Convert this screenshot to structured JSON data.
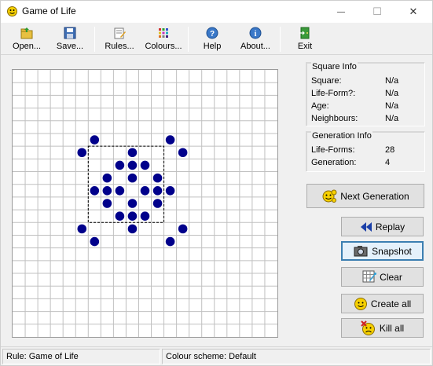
{
  "window": {
    "title": "Game of Life",
    "controls": {
      "minimize": "—",
      "maximize": "☐",
      "close": "✕"
    }
  },
  "toolbar": {
    "items": [
      {
        "label": "Open...",
        "icon": "open-folder-icon"
      },
      {
        "label": "Save...",
        "icon": "floppy-disk-icon"
      },
      {
        "label": "Rules...",
        "icon": "rules-icon"
      },
      {
        "label": "Colours...",
        "icon": "colour-palette-icon"
      },
      {
        "label": "Help",
        "icon": "help-icon"
      },
      {
        "label": "About...",
        "icon": "info-icon"
      },
      {
        "label": "Exit",
        "icon": "exit-door-icon"
      }
    ]
  },
  "grid": {
    "columns": 21,
    "rows": 21,
    "cell_color": "#00008b",
    "line_color": "#c0c0c0",
    "live_cells": [
      [
        6,
        5
      ],
      [
        12,
        5
      ],
      [
        5,
        6
      ],
      [
        9,
        6
      ],
      [
        13,
        6
      ],
      [
        8,
        7
      ],
      [
        9,
        7
      ],
      [
        10,
        7
      ],
      [
        7,
        8
      ],
      [
        9,
        8
      ],
      [
        11,
        8
      ],
      [
        6,
        9
      ],
      [
        7,
        9
      ],
      [
        8,
        9
      ],
      [
        10,
        9
      ],
      [
        11,
        9
      ],
      [
        12,
        9
      ],
      [
        7,
        10
      ],
      [
        9,
        10
      ],
      [
        11,
        10
      ],
      [
        8,
        11
      ],
      [
        9,
        11
      ],
      [
        10,
        11
      ],
      [
        5,
        12
      ],
      [
        9,
        12
      ],
      [
        13,
        12
      ],
      [
        6,
        13
      ],
      [
        12,
        13
      ]
    ],
    "selection": {
      "col_start": 6,
      "row_start": 6,
      "col_end": 12,
      "row_end": 12
    }
  },
  "square_info": {
    "title": "Square Info",
    "rows": [
      {
        "key": "Square:",
        "value": "N/a"
      },
      {
        "key": "Life-Form?:",
        "value": "N/a"
      },
      {
        "key": "Age:",
        "value": "N/a"
      },
      {
        "key": "Neighbours:",
        "value": "N/a"
      }
    ]
  },
  "generation_info": {
    "title": "Generation Info",
    "rows": [
      {
        "key": "Life-Forms:",
        "value": "28"
      },
      {
        "key": "Generation:",
        "value": "4"
      }
    ]
  },
  "buttons": {
    "next_generation": "Next Generation",
    "replay": "Replay",
    "snapshot": "Snapshot",
    "clear": "Clear",
    "create_all": "Create all",
    "kill_all": "Kill all"
  },
  "statusbar": {
    "rule": "Rule: Game of Life",
    "colour_scheme": "Colour scheme: Default"
  }
}
